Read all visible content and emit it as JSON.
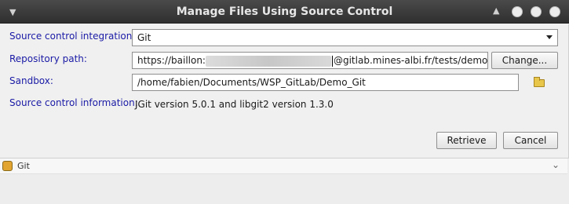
{
  "window": {
    "title": "Manage Files Using Source Control"
  },
  "form": {
    "integration": {
      "label": "Source control integration:",
      "value": "Git"
    },
    "repository": {
      "label": "Repository path:",
      "prefix": "https://baillon:",
      "suffix": "@gitlab.mines-albi.fr/tests/demo.git",
      "button": "Change..."
    },
    "sandbox": {
      "label": "Sandbox:",
      "value": "/home/fabien/Documents/WSP_GitLab/Demo_Git"
    },
    "info": {
      "label": "Source control information:",
      "value": "JGit version 5.0.1 and libgit2 version 1.3.0"
    }
  },
  "buttons": {
    "retrieve": "Retrieve",
    "cancel": "Cancel"
  },
  "panel": {
    "title": "Git"
  },
  "colors": {
    "label": "#1a1aa6",
    "titlebar": "#3a3a3a"
  }
}
